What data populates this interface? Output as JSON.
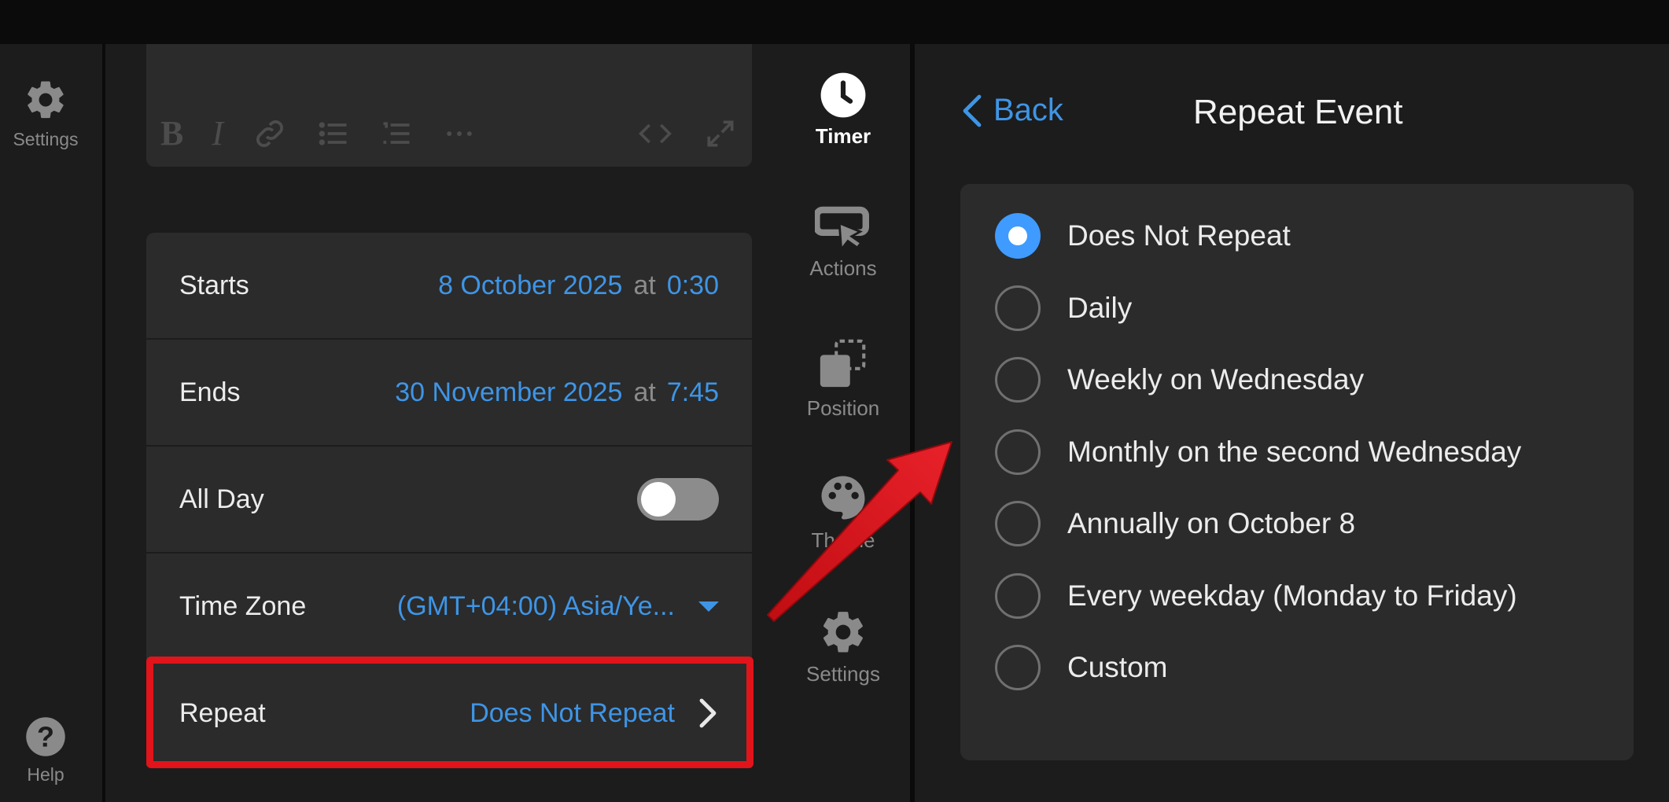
{
  "left_rail": {
    "settings_label": "Settings",
    "help_label": "Help"
  },
  "event_form": {
    "starts": {
      "label": "Starts",
      "date": "8 October 2025",
      "at": "at",
      "time": "0:30"
    },
    "ends": {
      "label": "Ends",
      "date": "30 November 2025",
      "at": "at",
      "time": "7:45"
    },
    "all_day": {
      "label": "All Day",
      "enabled": false
    },
    "time_zone": {
      "label": "Time Zone",
      "value": "(GMT+04:00) Asia/Ye..."
    },
    "repeat": {
      "label": "Repeat",
      "value": "Does Not Repeat"
    }
  },
  "tools": {
    "timer": "Timer",
    "actions": "Actions",
    "position": "Position",
    "theme": "Theme",
    "settings": "Settings"
  },
  "repeat_panel": {
    "back_label": "Back",
    "title": "Repeat Event",
    "selected": "Does Not Repeat",
    "options": [
      "Does Not Repeat",
      "Daily",
      "Weekly on Wednesday",
      "Monthly on the second Wednesday",
      "Annually on October 8",
      "Every weekday (Monday to Friday)",
      "Custom"
    ]
  },
  "colors": {
    "accent_blue": "#3e95e6",
    "highlight_red": "#e0141a",
    "background": "#1c1c1c",
    "card": "#2b2b2b"
  }
}
